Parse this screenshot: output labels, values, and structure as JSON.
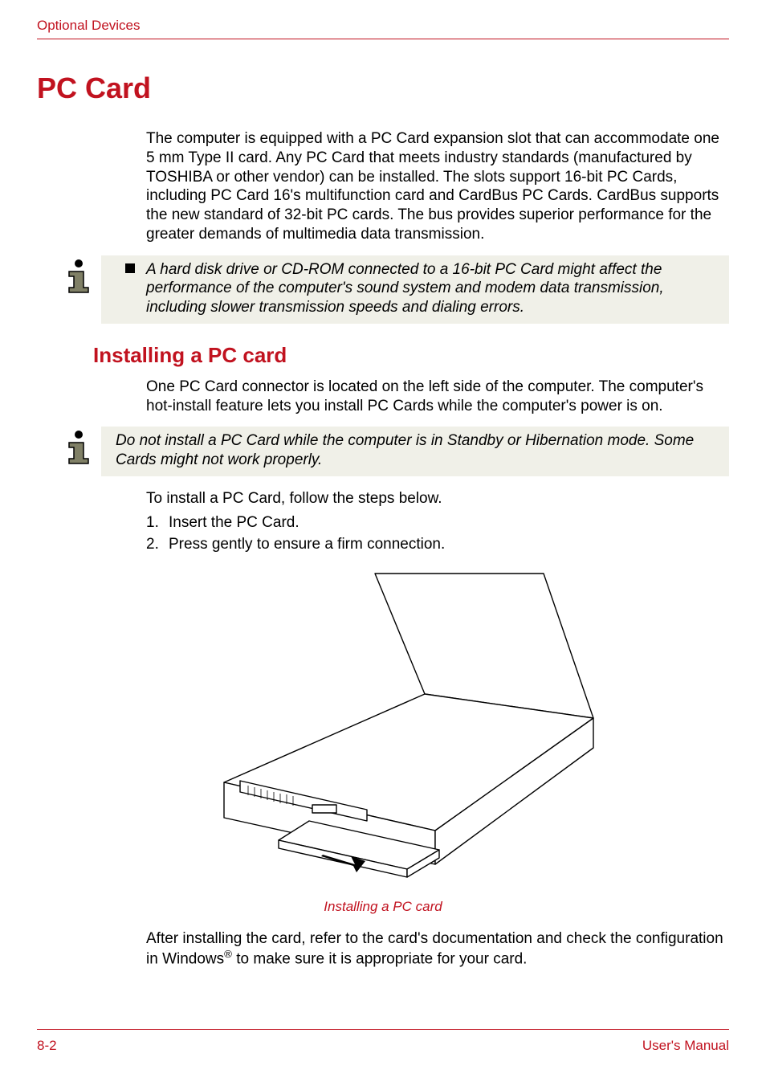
{
  "header": "Optional Devices",
  "heading1": "PC Card",
  "intro": "The computer is equipped with a PC Card expansion slot that can accommodate one 5 mm Type II card. Any PC Card that meets industry standards (manufactured by TOSHIBA or other vendor) can be installed. The slots support 16-bit PC Cards, including PC Card 16's multifunction card and CardBus PC Cards. CardBus supports the new standard of 32-bit PC cards. The bus provides superior performance for the greater demands of multimedia data transmission.",
  "note1": "A hard disk drive or CD-ROM connected to a 16-bit PC Card might affect the performance of the computer's sound system and modem data transmission, including slower transmission speeds and dialing errors.",
  "heading2": "Installing a PC card",
  "install_para": "One PC Card connector is located on the left side of the computer. The computer's hot-install feature lets you install PC Cards while the computer's power is on.",
  "note2": "Do not install a PC Card while the computer is in Standby or Hibernation mode. Some Cards might not work properly.",
  "steps_intro": "To install a PC Card, follow the steps below.",
  "steps": [
    "Insert the PC Card.",
    "Press gently to ensure a firm connection."
  ],
  "figure_caption": "Installing a PC card",
  "after_para_1": "After installing the card, refer to the card's documentation and check the configuration in Windows",
  "after_para_2": " to make sure it is appropriate for your card.",
  "reg_mark": "®",
  "footer_left": "8-2",
  "footer_right": "User's Manual"
}
